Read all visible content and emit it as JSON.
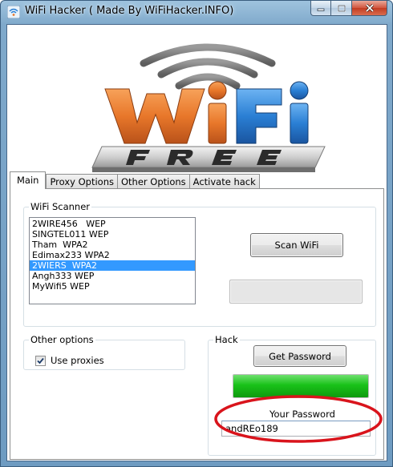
{
  "window": {
    "title": "WiFi  Hacker ( Made By WiFiHacker.INFO)",
    "icon": "wifi-app-icon"
  },
  "caption_buttons": [
    "minimize",
    "maximize",
    "close"
  ],
  "logo": {
    "word": "WiFi",
    "sub": "FREE",
    "colors": {
      "wi": "#e8772a",
      "fi": "#2a7fd4",
      "dot": "#e8772a",
      "plate": "#c8c8c8"
    }
  },
  "tabs": [
    {
      "label": "Main",
      "active": true
    },
    {
      "label": "Proxy Options",
      "active": false
    },
    {
      "label": "Other Options",
      "active": false
    },
    {
      "label": "Activate hack",
      "active": false
    }
  ],
  "scanner": {
    "title": "WiFi Scanner",
    "networks": [
      {
        "label": "2WIRE456   WEP",
        "selected": false
      },
      {
        "label": "SINGTEL011 WEP",
        "selected": false
      },
      {
        "label": "Tham  WPA2",
        "selected": false
      },
      {
        "label": "Edimax233 WPA2",
        "selected": false
      },
      {
        "label": "2WIERS  WPA2",
        "selected": true
      },
      {
        "label": "Angh333 WEP",
        "selected": false
      },
      {
        "label": "MyWifi5 WEP",
        "selected": false
      }
    ],
    "scan_button": "Scan WiFi",
    "scan_progress": 0
  },
  "other_options": {
    "title": "Other options",
    "use_proxies_label": "Use proxies",
    "use_proxies_checked": true
  },
  "hack": {
    "title": "Hack",
    "get_password_button": "Get Password",
    "progress": 1.0,
    "progress_color": "#19c219",
    "password_label": "Your Password",
    "password_value": "andREo189",
    "highlight_color": "#d9141c"
  }
}
